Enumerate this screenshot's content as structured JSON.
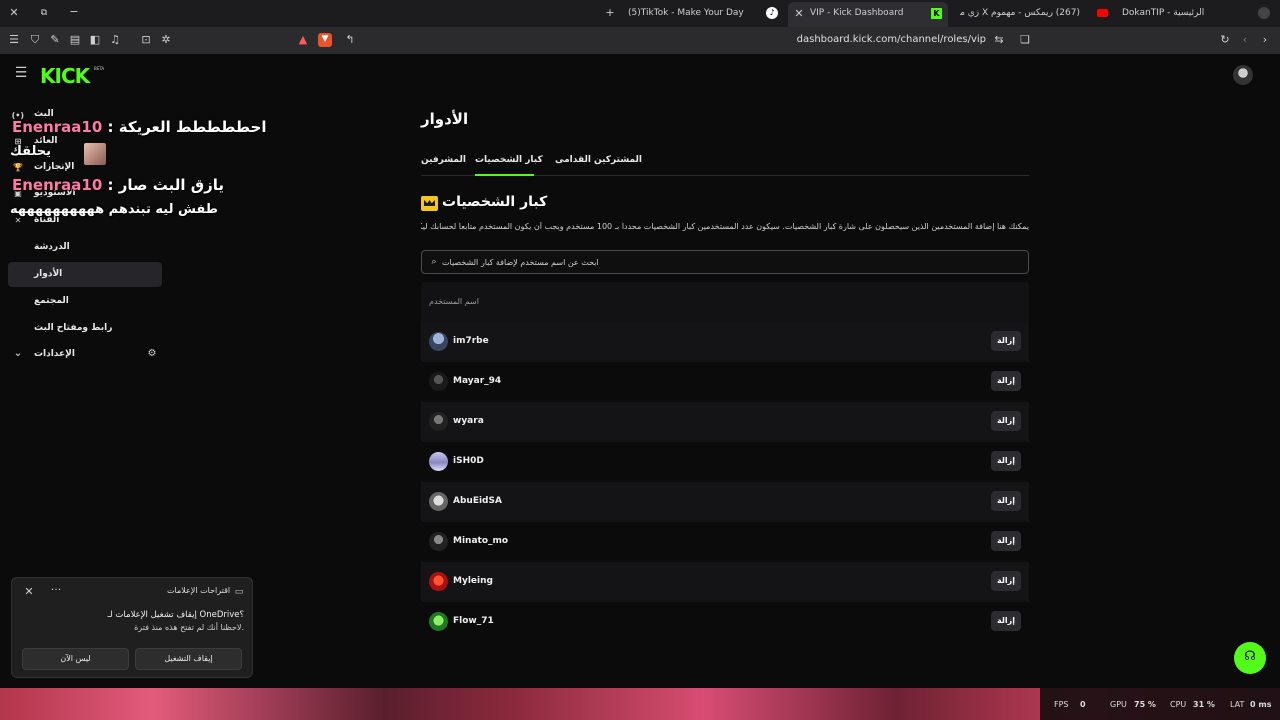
{
  "browser": {
    "tabs": [
      {
        "label": "(5)TikTok - Make Your Day"
      },
      {
        "label": "VIP - Kick Dashboard"
      },
      {
        "label": "(267) ريمكس - مهموم X زي مي"
      },
      {
        "label": "DokanTIP - الرئيسية"
      }
    ],
    "url": "dashboard.kick.com/channel/roles/vip"
  },
  "sidebar": {
    "items": [
      {
        "label": "البث"
      },
      {
        "label": "العائد"
      },
      {
        "label": "الإنجازات"
      },
      {
        "label": "الاستوديو"
      },
      {
        "label": "القناة"
      },
      {
        "label": "الدردشة"
      },
      {
        "label": "الأدوار"
      },
      {
        "label": "المجتمع"
      },
      {
        "label": "رابط ومفتاح البث"
      },
      {
        "label": "الإعدادات"
      }
    ]
  },
  "overlay": {
    "line1_user": "Enenraa10",
    "line1_msg": ": احططططط العريكة",
    "line1_tail": "يحلقك",
    "line2_user": "Enenraa10",
    "line2_msg": ": يازق البث صار",
    "line2_tail": "طفش ليه تبندهم ههههههههههه"
  },
  "main": {
    "title": "الأدوار",
    "tabs": [
      {
        "label": "المشرفين"
      },
      {
        "label": "كبار الشخصيات"
      },
      {
        "label": "المشتركين القدامى"
      }
    ],
    "vip_heading": "كبار الشخصيات",
    "vip_description": "يمكنك هنا إضافة المستخدمين الذين سيحصلون على شارة كبار الشخصيات. سيكون عدد المستخدمين كبار الشخصيات محدداً بـ 100 مستخدم ويجب أن يكون المستخدم متابعاً لحسابك ليكون مؤهلاً.",
    "search_placeholder": "ابحث عن اسم مستخدم لإضافة كبار الشخصيات",
    "column_header": "اسم المستخدم",
    "remove_label": "إزالة",
    "users": [
      {
        "name": "im7rbe"
      },
      {
        "name": "Mayar_94"
      },
      {
        "name": "wyara"
      },
      {
        "name": "iSH0D"
      },
      {
        "name": "AbuEidSA"
      },
      {
        "name": "Minato_mo"
      },
      {
        "name": "Myleing"
      },
      {
        "name": "Flow_71"
      }
    ]
  },
  "notification": {
    "header": "اقتراحات الإعلامات",
    "title": "إيقاف تشغيل الإعلامات لـ OneDrive؟",
    "body": "لاحظنا أنك لم تفتح هذه منذ فترة.",
    "confirm": "إيقاف التشغيل",
    "dismiss": "ليس الآن"
  },
  "perf": {
    "fps_label": "FPS",
    "fps": "0",
    "gpu_label": "GPU",
    "gpu": "75 %",
    "cpu_label": "CPU",
    "cpu": "31 %",
    "lat_label": "LAT",
    "lat": "0 ms"
  },
  "colors": {
    "accent": "#53fc18",
    "crown": "#f5c61a"
  }
}
